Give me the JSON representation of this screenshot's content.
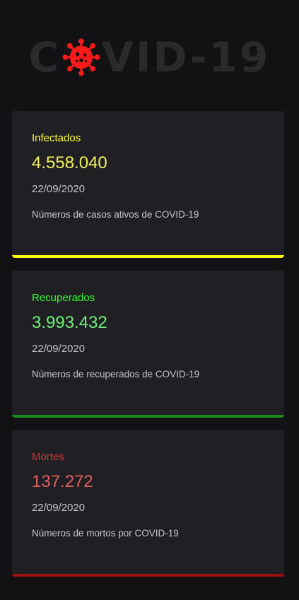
{
  "logo": {
    "text_before": "C",
    "text_after": "VID-19",
    "virus_icon": "coronavirus-icon",
    "virus_color": "#ff1a1a",
    "text_color": "#2a2a2c"
  },
  "cards": [
    {
      "title": "Infectados",
      "value": "4.558.040",
      "date": "22/09/2020",
      "description": "Números de casos ativos de COVID-19",
      "title_color": "#ffff2e",
      "value_color": "#f0f05a",
      "bar_color": "#ffff00"
    },
    {
      "title": "Recuperados",
      "value": "3.993.432",
      "date": "22/09/2020",
      "description": "Números de recuperados de COVID-19",
      "title_color": "#2eff2e",
      "value_color": "#6ef27a",
      "bar_color": "#1f8a1f"
    },
    {
      "title": "Mortes",
      "value": "137.272",
      "date": "22/09/2020",
      "description": "Números de mortos por COVID-19",
      "title_color": "#d13636",
      "value_color": "#e15c5c",
      "bar_color": "#a10f0f"
    }
  ]
}
